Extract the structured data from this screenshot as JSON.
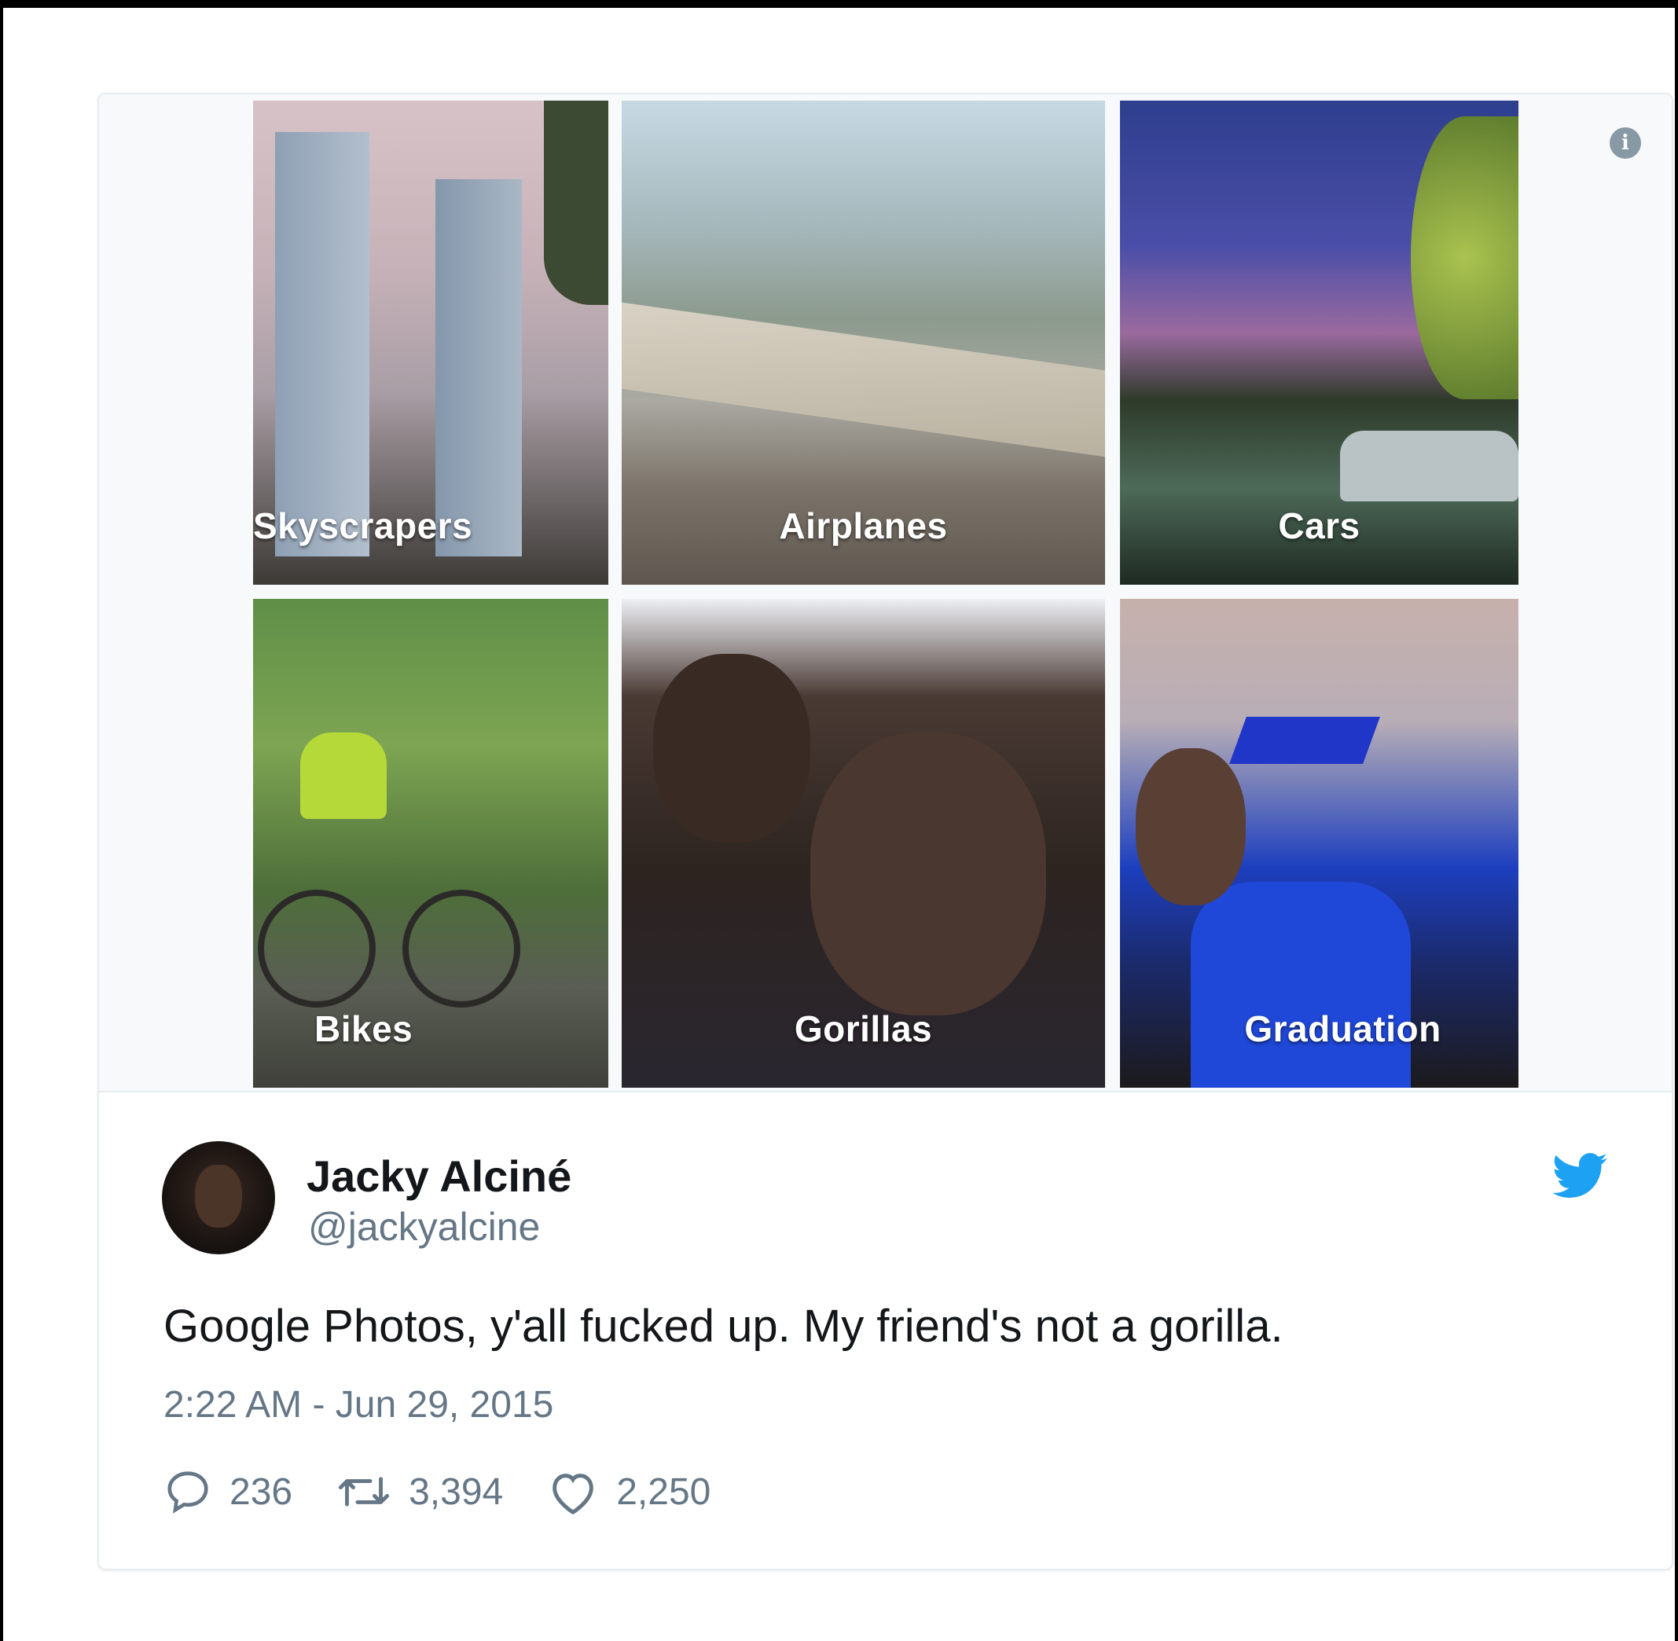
{
  "tiles": [
    {
      "label": "Skyscrapers"
    },
    {
      "label": "Airplanes"
    },
    {
      "label": "Cars"
    },
    {
      "label": "Bikes"
    },
    {
      "label": "Gorillas"
    },
    {
      "label": "Graduation"
    }
  ],
  "tweet": {
    "display_name": "Jacky Alciné",
    "handle": "@jackyalcine",
    "text": "Google Photos, y'all fucked up. My friend's not a gorilla.",
    "timestamp": "2:22 AM - Jun 29, 2015",
    "replies": "236",
    "retweets": "3,394",
    "likes": "2,250"
  },
  "icons": {
    "info": "info-icon",
    "brand": "twitter-bird-icon",
    "reply": "reply-icon",
    "retweet": "retweet-icon",
    "like": "heart-icon"
  },
  "colors": {
    "twitter_blue": "#1da1f2",
    "secondary_text": "#657786",
    "primary_text": "#14171a"
  }
}
